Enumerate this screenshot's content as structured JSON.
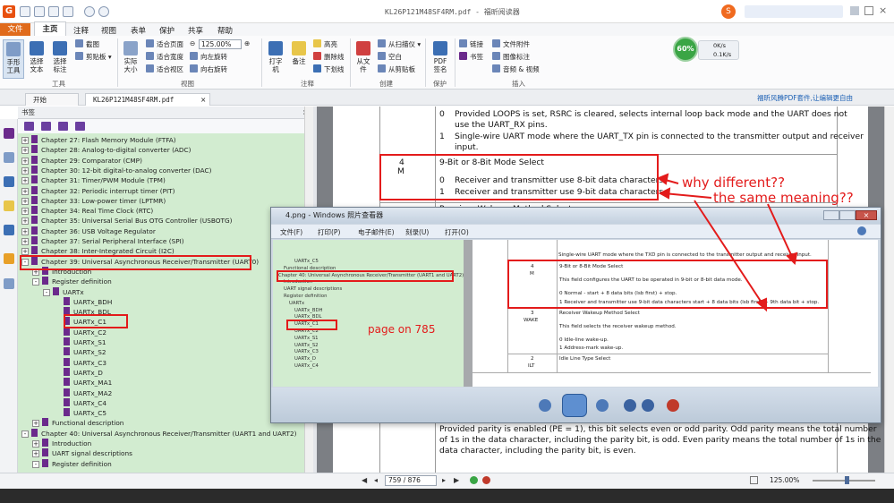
{
  "window": {
    "title": "KL26P121M48SF4RM.pdf - 福昕阅读器"
  },
  "menu": {
    "items": [
      "文件",
      "主页",
      "注释",
      "视图",
      "表单",
      "保护",
      "共享",
      "帮助"
    ]
  },
  "ribbon": {
    "tools": {
      "hand": "手形工具",
      "select_text": "选择文本",
      "select_annot": "选择标注",
      "screenshot": "截图",
      "clipboard": "剪贴板",
      "actual_size": "实际大小",
      "fit_page": "适合页面",
      "fit_width": "适合宽度",
      "fit_view": "适合视区",
      "zoom_value": "125.00%",
      "rotate_left": "向左旋转",
      "rotate_right": "向右旋转",
      "typewriter": "打字机",
      "note": "备注",
      "highlight": "高亮",
      "strikeout": "删除线",
      "underline": "下划线",
      "from_file": "从文件",
      "from_scanner": "从扫描仪",
      "blank": "空白",
      "from_clipboard": "从剪贴板",
      "pdf_sign": "PDF签名",
      "link": "链接",
      "bookmark": "书签",
      "attach": "文件附件",
      "image_annot": "图像标注",
      "audio_video": "音频 & 视频"
    },
    "groups": {
      "tools": "工具",
      "view": "视图",
      "comment": "注释",
      "create": "创建",
      "protect": "保护",
      "insert": "插入"
    },
    "speed": {
      "percent": "60%",
      "up": "0K/s",
      "down": "0.1K/s"
    }
  },
  "tabs": {
    "start": "开始",
    "doc": "KL26P121M48SF4RM.pdf",
    "close": "×",
    "advert": "福昕风腾PDF套件,让编辑更自由"
  },
  "sidebar": {
    "title": "书签",
    "close": "×",
    "items": [
      {
        "label": "Chapter 27: Flash Memory Module (FTFA)",
        "level": 0,
        "exp": "+"
      },
      {
        "label": "Chapter 28: Analog-to-digital converter (ADC)",
        "level": 0,
        "exp": "+"
      },
      {
        "label": "Chapter 29: Comparator (CMP)",
        "level": 0,
        "exp": "+"
      },
      {
        "label": "Chapter 30: 12-bit digital-to-analog converter (DAC)",
        "level": 0,
        "exp": "+"
      },
      {
        "label": "Chapter 31: Timer/PWM Module (TPM)",
        "level": 0,
        "exp": "+"
      },
      {
        "label": "Chapter 32: Periodic interrupt timer (PIT)",
        "level": 0,
        "exp": "+"
      },
      {
        "label": "Chapter 33: Low-power timer (LPTMR)",
        "level": 0,
        "exp": "+"
      },
      {
        "label": "Chapter 34: Real Time Clock (RTC)",
        "level": 0,
        "exp": "+"
      },
      {
        "label": "Chapter 35: Universal Serial Bus OTG Controller (USBOTG)",
        "level": 0,
        "exp": "+"
      },
      {
        "label": "Chapter 36: USB Voltage Regulator",
        "level": 0,
        "exp": "+"
      },
      {
        "label": "Chapter 37: Serial Peripheral Interface (SPI)",
        "level": 0,
        "exp": "+"
      },
      {
        "label": "Chapter 38: Inter-Integrated Circuit (I2C)",
        "level": 0,
        "exp": "+"
      },
      {
        "label": "Chapter 39:  Universal Asynchronous Receiver/Transmitter (UART0)",
        "level": 0,
        "exp": "-"
      },
      {
        "label": "Introduction",
        "level": 1,
        "exp": "+"
      },
      {
        "label": "Register definition",
        "level": 1,
        "exp": "-"
      },
      {
        "label": "UARTx",
        "level": 2,
        "exp": "-"
      },
      {
        "label": "UARTx_BDH",
        "level": 3,
        "exp": ""
      },
      {
        "label": "UARTx_BDL",
        "level": 3,
        "exp": ""
      },
      {
        "label": "UARTx_C1",
        "level": 3,
        "exp": ""
      },
      {
        "label": "UARTx_C2",
        "level": 3,
        "exp": ""
      },
      {
        "label": "UARTx_S1",
        "level": 3,
        "exp": ""
      },
      {
        "label": "UARTx_S2",
        "level": 3,
        "exp": ""
      },
      {
        "label": "UARTx_C3",
        "level": 3,
        "exp": ""
      },
      {
        "label": "UARTx_D",
        "level": 3,
        "exp": ""
      },
      {
        "label": "UARTx_MA1",
        "level": 3,
        "exp": ""
      },
      {
        "label": "UARTx_MA2",
        "level": 3,
        "exp": ""
      },
      {
        "label": "UARTx_C4",
        "level": 3,
        "exp": ""
      },
      {
        "label": "UARTx_C5",
        "level": 3,
        "exp": ""
      },
      {
        "label": "Functional description",
        "level": 1,
        "exp": "+"
      },
      {
        "label": "Chapter 40: Universal Asynchronous Receiver/Transmitter (UART1 and UART2)",
        "level": 0,
        "exp": "-"
      },
      {
        "label": "Introduction",
        "level": 1,
        "exp": "+"
      },
      {
        "label": "UART signal descriptions",
        "level": 1,
        "exp": "+"
      },
      {
        "label": "Register definition",
        "level": 1,
        "exp": "-"
      }
    ]
  },
  "doc": {
    "rows": [
      {
        "num": "0",
        "text": "Provided LOOPS is set, RSRC is cleared, selects internal loop back mode and the UART does not"
      },
      {
        "num": "",
        "text": "use the UART_RX pins."
      },
      {
        "num": "1",
        "text": "Single-wire UART mode where the UART_TX pin is connected to the transmitter output and receiver"
      },
      {
        "num": "",
        "text": "input."
      }
    ],
    "field_num": "4",
    "field_name": "M",
    "field_title": "9-Bit or 8-Bit Mode Select",
    "m0": "Receiver and transmitter use 8-bit data characters.",
    "m1": "Receiver and transmitter use 9-bit data characters.",
    "m0_num": "0",
    "m1_num": "1",
    "next_num": "3",
    "next_title": "Receiver Wakeup Method Select",
    "parity_text1": "Provided parity is enabled (PE = 1), this bit selects even or odd parity. Odd parity means the total number",
    "parity_text2": "of 1s in the data character, including the parity bit, is odd. Even parity means the total number of 1s in the",
    "parity_text3": "data character, including the parity bit, is even."
  },
  "annotations": {
    "why_different": "why different??",
    "same_meaning": "the same meaning??",
    "page_on": "page on 785"
  },
  "viewer": {
    "title": "4.png - Windows 照片查看器",
    "menu": [
      "文件(F)",
      "打印(P)",
      "电子邮件(E)",
      "刻录(U)",
      "打开(O)"
    ],
    "tree": [
      "UARTx_C5",
      "Functional description",
      "Chapter 40: Universal Asynchronous Receiver/Transmitter (UART1 and UART2)",
      "Introduction",
      "UART signal descriptions",
      "Register definition",
      "UARTx",
      "UARTx_BDH",
      "UARTx_BDL",
      "UARTx_C1",
      "UARTx_C2",
      "UARTx_S1",
      "UARTx_S2",
      "UARTx_C3",
      "UARTx_D",
      "UARTx_C4"
    ],
    "page": {
      "top": "Single-wire UART mode where the TXD pin is connected to the transmitter output and receiver input.",
      "f4_num": "4",
      "f4_name": "M",
      "f4_title": "9-Bit or 8-Bit Mode Select",
      "f4_desc": "This field configures the UART to be operated in 9-bit or 8-bit data mode.",
      "f4_0": "0     Normal - start + 8 data bits (lsb first) + stop.",
      "f4_1": "1     Receiver and transmitter use 9-bit data characters start + 8 data bits (lsb first) + 9th data bit + stop.",
      "f3_num": "3",
      "f3_name": "WAKE",
      "f3_title": "Receiver Wakeup Method Select",
      "f3_desc": "This field selects the receiver wakeup method.",
      "f3_0": "0     Idle-line wake-up.",
      "f3_1": "1     Address-mark wake-up.",
      "f2_num": "2",
      "f2_name": "ILT",
      "f2_title": "Idle Line Type Select"
    }
  },
  "status": {
    "page": "759 / 876",
    "zoom": "125.00%"
  },
  "colors": {
    "accent": "#e06b1c",
    "tree_bg": "#d2ecd0",
    "annotation": "#e31b1b",
    "bookmark": "#6b2a8c"
  }
}
